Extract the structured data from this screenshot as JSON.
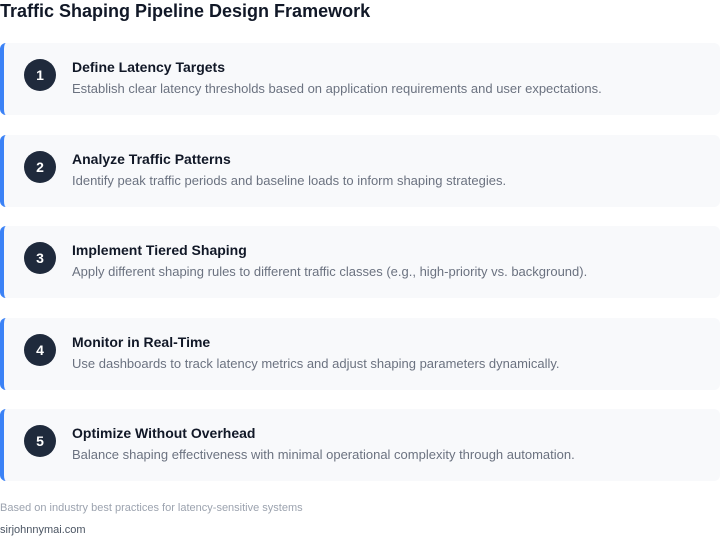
{
  "title": "Traffic Shaping Pipeline Design Framework",
  "steps": [
    {
      "number": "1",
      "title": "Define Latency Targets",
      "description": "Establish clear latency thresholds based on application requirements and user expectations."
    },
    {
      "number": "2",
      "title": "Analyze Traffic Patterns",
      "description": "Identify peak traffic periods and baseline loads to inform shaping strategies."
    },
    {
      "number": "3",
      "title": "Implement Tiered Shaping",
      "description": "Apply different shaping rules to different traffic classes (e.g., high-priority vs. background)."
    },
    {
      "number": "4",
      "title": "Monitor in Real-Time",
      "description": "Use dashboards to track latency metrics and adjust shaping parameters dynamically."
    },
    {
      "number": "5",
      "title": "Optimize Without Overhead",
      "description": "Balance shaping effectiveness with minimal operational complexity through automation."
    }
  ],
  "footnote": "Based on industry best practices for latency-sensitive systems",
  "site": "sirjohnnymai.com",
  "colors": {
    "accent": "#3b82f6",
    "badge": "#1f2a3c",
    "card_background": "#f8f9fb"
  }
}
